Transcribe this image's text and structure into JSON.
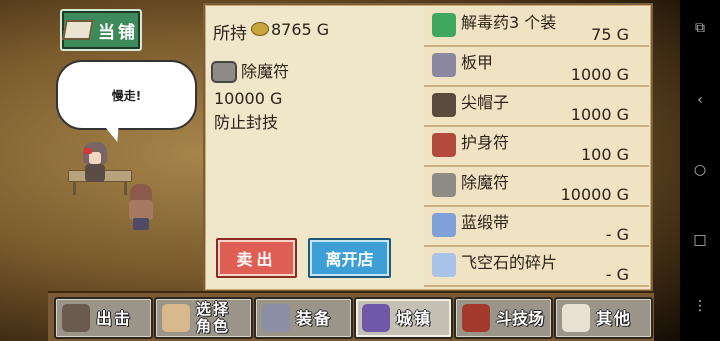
{
  "shop_button": {
    "label": "当铺"
  },
  "npc_speech": "慢走!",
  "panel": {
    "money_label": "所持",
    "money_value": "8765 G",
    "selected": {
      "name": "除魔符",
      "price": "10000 G",
      "description": "防止封技"
    },
    "sell_label": "卖出",
    "leave_label": "离开店"
  },
  "items": [
    {
      "name": "解毒药3 个装",
      "price": "75 G",
      "icon": "potion-icon",
      "color": "#3fa85e"
    },
    {
      "name": "板甲",
      "price": "1000 G",
      "icon": "armor-icon",
      "color": "#8a88a0"
    },
    {
      "name": "尖帽子",
      "price": "1000 G",
      "icon": "hat-icon",
      "color": "#5b4a3e"
    },
    {
      "name": "护身符",
      "price": "100 G",
      "icon": "amulet-icon",
      "color": "#b34a3c"
    },
    {
      "name": "除魔符",
      "price": "10000 G",
      "icon": "charm-icon",
      "color": "#8e8b84"
    },
    {
      "name": "蓝缎带",
      "price": "- G",
      "icon": "ribbon-icon",
      "color": "#7fa0d8"
    },
    {
      "name": "飞空石的碎片",
      "price": "- G",
      "icon": "crystal-icon",
      "color": "#a9c4e8"
    }
  ],
  "nav": [
    {
      "label": "出击",
      "icon": "sortie-icon",
      "color": "#6a5a50"
    },
    {
      "label": "选择角色",
      "icon": "character-icon",
      "color": "#d9b98c"
    },
    {
      "label": "装备",
      "icon": "equipment-icon",
      "color": "#8c8fa6"
    },
    {
      "label": "城镇",
      "icon": "town-icon",
      "color": "#6f58a8",
      "active": true
    },
    {
      "label": "斗技场",
      "icon": "arena-icon",
      "color": "#a33a2c"
    },
    {
      "label": "其他",
      "icon": "other-icon",
      "color": "#e8e0d2"
    }
  ]
}
